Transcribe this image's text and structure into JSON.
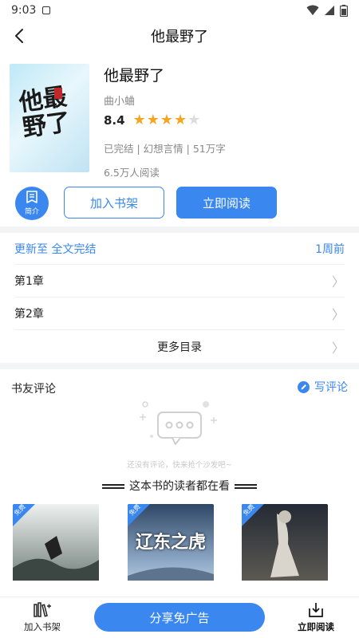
{
  "status_bar": {
    "time": "9:03"
  },
  "nav": {
    "title": "他最野了"
  },
  "book": {
    "title": "他最野了",
    "author": "曲小蛐",
    "score": "8.4",
    "stars_filled": 4,
    "stars_total": 5,
    "meta": "已完结 | 幻想言情 | 51万字",
    "readers": "6.5万人阅读",
    "cover_text": "他最野了"
  },
  "actions": {
    "intro_label": "简介",
    "add_shelf_label": "加入书架",
    "read_label": "立即阅读"
  },
  "toc": {
    "update_label": "更新至 全文完结",
    "update_time": "1周前",
    "chapters": [
      "第1章",
      "第2章"
    ],
    "more_label": "更多目录"
  },
  "comments": {
    "heading": "书友评论",
    "write_label": "写评论",
    "empty_text": "还没有评论，快来抢个沙发吧~"
  },
  "recommend": {
    "heading": "这本书的读者都在看",
    "badge": "免费",
    "books": [
      {
        "cover_text": "",
        "colors": [
          "#dfe7e6",
          "#4b5b58"
        ]
      },
      {
        "cover_text": "辽东之虎",
        "colors": [
          "#3a5270",
          "#c9d7e8"
        ]
      },
      {
        "cover_text": "",
        "colors": [
          "#2a2f3a",
          "#c7c2b7"
        ]
      }
    ]
  },
  "bottom_bar": {
    "shelf_label": "加入书架",
    "share_label": "分享免广告",
    "read_label": "立即阅读"
  },
  "colors": {
    "accent": "#3a87f0",
    "star": "#f4a623"
  }
}
